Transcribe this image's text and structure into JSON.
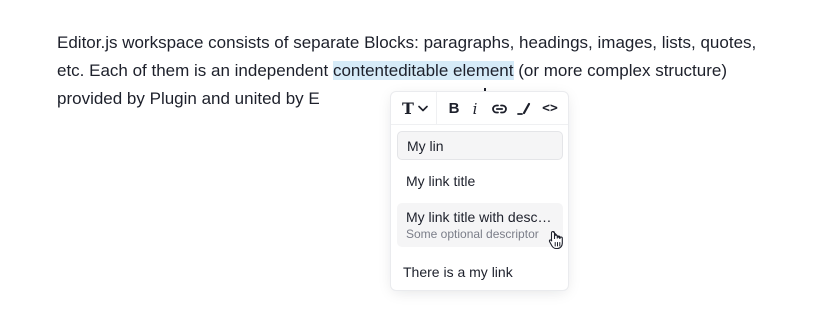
{
  "paragraph": {
    "before": "Editor.js workspace consists of separate Blocks: paragraphs, headings, images, lists, quotes, etc. Each of them is an independent ",
    "selected": "contenteditable element",
    "after": " (or more complex structure) provided by Plugin and united by E"
  },
  "toolbar": {
    "convert_icon": "text-type-icon",
    "convert_label": "T",
    "bold_label": "B",
    "italic_label": "i",
    "link_icon": "link-icon",
    "marker_icon": "marker-icon",
    "code_label": "<>"
  },
  "link_search": {
    "value": "My lin"
  },
  "suggestions": [
    {
      "title": "My link title",
      "description": ""
    },
    {
      "title": "My link title with description",
      "description": "Some optional descriptor"
    },
    {
      "title": "There is a my link",
      "description": ""
    }
  ],
  "colors": {
    "selection": "#d6ebf8",
    "hover": "#f5f5f6",
    "text": "#1d202b",
    "muted": "#7b7e89"
  }
}
